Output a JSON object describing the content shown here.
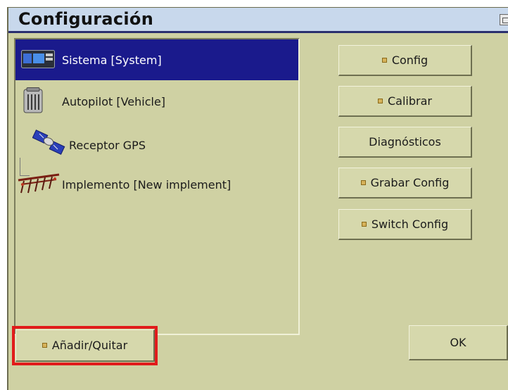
{
  "window": {
    "title": "Configuración"
  },
  "tree": {
    "items": [
      {
        "label": "Sistema [System]",
        "icon": "display-unit-icon",
        "selected": true
      },
      {
        "label": "Autopilot [Vehicle]",
        "icon": "controller-icon",
        "selected": false
      },
      {
        "label": "Receptor GPS",
        "icon": "satellite-icon",
        "selected": false
      },
      {
        "label": "Implemento [New implement]",
        "icon": "implement-icon",
        "selected": false
      }
    ]
  },
  "buttons": {
    "config": "Config",
    "calibrar": "Calibrar",
    "diagnosticos": "Diagnósticos",
    "grabar_config": "Grabar Config",
    "switch_config": "Switch Config",
    "anadir_quitar": "Añadir/Quitar",
    "ok": "OK"
  },
  "colors": {
    "panel_bg": "#cfd1a3",
    "selection": "#1a1a8c",
    "titlebar_underline": "#2a2f6e",
    "highlight": "#e11b1b"
  }
}
